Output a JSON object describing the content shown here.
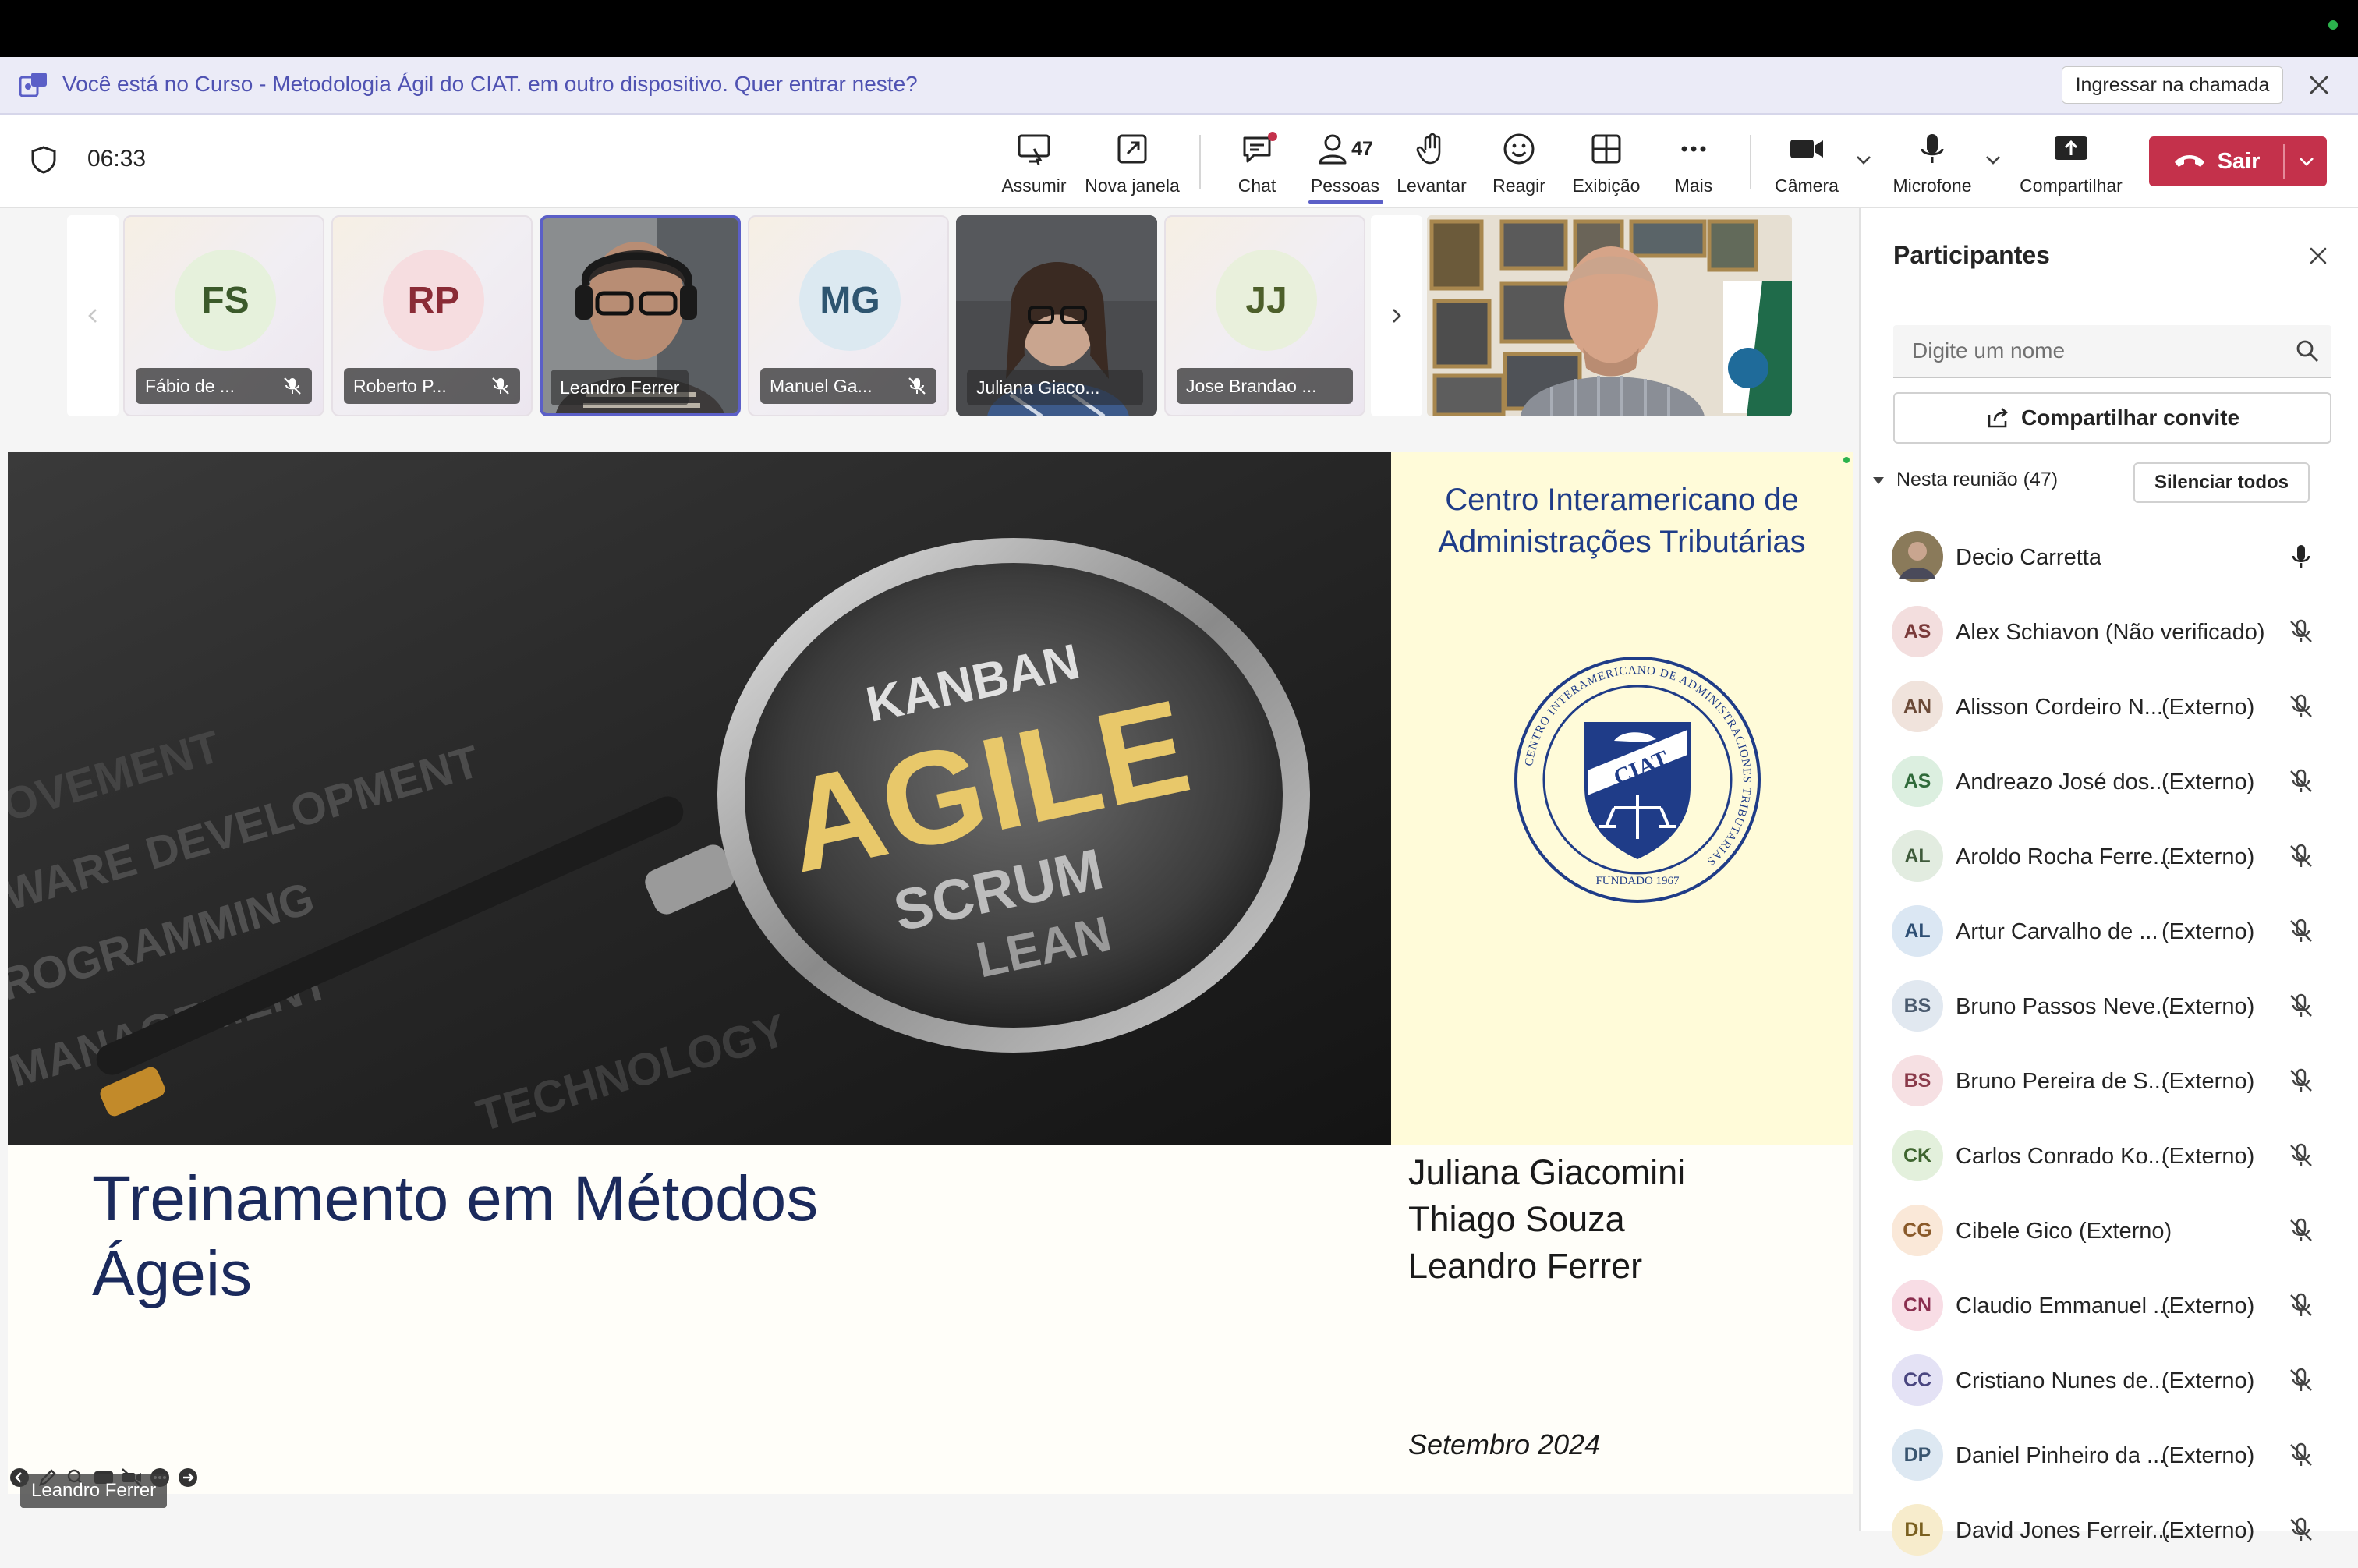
{
  "banner": {
    "text": "Você está no Curso - Metodologia Ágil do CIAT. em outro dispositivo. Quer entrar neste?",
    "join_label": "Ingressar na chamada"
  },
  "meeting": {
    "timer": "06:33"
  },
  "toolbar": {
    "assumir": "Assumir",
    "nova_janela": "Nova janela",
    "chat": "Chat",
    "pessoas": "Pessoas",
    "pessoas_count": "47",
    "levantar": "Levantar",
    "reagir": "Reagir",
    "exibicao": "Exibição",
    "mais": "Mais",
    "camera": "Câmera",
    "microfone": "Microfone",
    "compartilhar": "Compartilhar",
    "sair": "Sair"
  },
  "video_tiles": [
    {
      "initials": "FS",
      "name": "Fábio de ...",
      "color": "#e6f1dc",
      "fg": "#3b5a2a"
    },
    {
      "initials": "RP",
      "name": "Roberto P...",
      "color": "#f6dde0",
      "fg": "#8a2b36"
    },
    {
      "initials": "",
      "name": "Leandro Ferrer"
    },
    {
      "initials": "MG",
      "name": "Manuel Ga...",
      "color": "#dce9f1",
      "fg": "#2e5570"
    },
    {
      "initials": "",
      "name": "Juliana Giaco..."
    },
    {
      "initials": "JJ",
      "name": "Jose Brandao ...",
      "color": "#e9f0dc",
      "fg": "#4d5f2a"
    }
  ],
  "slide": {
    "org": "Centro Interamericano de\nAdministrações Tributárias",
    "title_line1": "Treinamento em Métodos",
    "title_line2": "Ágeis",
    "presenters": [
      "Juliana Giacomini",
      "Thiago Souza",
      "Leandro Ferrer"
    ],
    "date": "Setembro 2024",
    "photo_words": [
      "KANBAN",
      "AGILE",
      "SCRUM",
      "LEAN",
      "SOFTWARE DEVELOPMENT",
      "IMPROVEMENT",
      "PROGRAMMING",
      "MANAGEMENT",
      "TECHNOLOGY"
    ],
    "seal_text": "CIAT",
    "seal_ring": "CENTRO INTERAMERICANO DE ADMINISTRACIONES TRIBUTARIAS",
    "seal_founded": "FUNDADO 1967"
  },
  "speaker_label": "Leandro Ferrer",
  "panel": {
    "title": "Participantes",
    "search_placeholder": "Digite um nome",
    "invite_label": "Compartilhar convite",
    "section_label": "Nesta reunião (47)",
    "mute_all": "Silenciar todos",
    "participants": [
      {
        "initials": "",
        "name": "Decio Carretta",
        "ext": "",
        "photo": true,
        "muted": false
      },
      {
        "initials": "AS",
        "name": "Alex Schiavon (Não verificado)",
        "ext": "",
        "color": "#f3dede",
        "fg": "#7a3a3a",
        "muted": true
      },
      {
        "initials": "AN",
        "name": "Alisson Cordeiro N...",
        "ext": "(Externo)",
        "color": "#f0e3dc",
        "fg": "#6b4a38",
        "muted": true
      },
      {
        "initials": "AS",
        "name": "Andreazo José dos...",
        "ext": "(Externo)",
        "color": "#dcefe0",
        "fg": "#2f6a3a",
        "muted": true
      },
      {
        "initials": "AL",
        "name": "Aroldo Rocha Ferre...",
        "ext": "(Externo)",
        "color": "#e2ece0",
        "fg": "#3e5a3a",
        "muted": true
      },
      {
        "initials": "AL",
        "name": "Artur Carvalho de ...",
        "ext": "(Externo)",
        "color": "#dbe7f3",
        "fg": "#2e4f74",
        "muted": true
      },
      {
        "initials": "BS",
        "name": "Bruno Passos Neve...",
        "ext": "(Externo)",
        "color": "#e1e8f0",
        "fg": "#4a5a6e",
        "muted": true
      },
      {
        "initials": "BS",
        "name": "Bruno Pereira de S...",
        "ext": "(Externo)",
        "color": "#f6e0e3",
        "fg": "#8a3a4a",
        "muted": true
      },
      {
        "initials": "CK",
        "name": "Carlos Conrado Ko...",
        "ext": "(Externo)",
        "color": "#e3f0dc",
        "fg": "#3f6630",
        "muted": true
      },
      {
        "initials": "CG",
        "name": "Cibele Gico (Externo)",
        "ext": "",
        "color": "#fae8d8",
        "fg": "#8a5a2a",
        "muted": true
      },
      {
        "initials": "CN",
        "name": "Claudio Emmanuel ...",
        "ext": "(Externo)",
        "color": "#f8dde5",
        "fg": "#8a2f4f",
        "muted": true
      },
      {
        "initials": "CC",
        "name": "Cristiano Nunes de...",
        "ext": "(Externo)",
        "color": "#e4e2f5",
        "fg": "#4a4680",
        "muted": true
      },
      {
        "initials": "DP",
        "name": "Daniel Pinheiro da ...",
        "ext": "(Externo)",
        "color": "#dde8f2",
        "fg": "#3a5670",
        "muted": true
      },
      {
        "initials": "DL",
        "name": "David Jones Ferreir...",
        "ext": "(Externo)",
        "color": "#f7eccc",
        "fg": "#7a6020",
        "muted": true
      }
    ]
  }
}
